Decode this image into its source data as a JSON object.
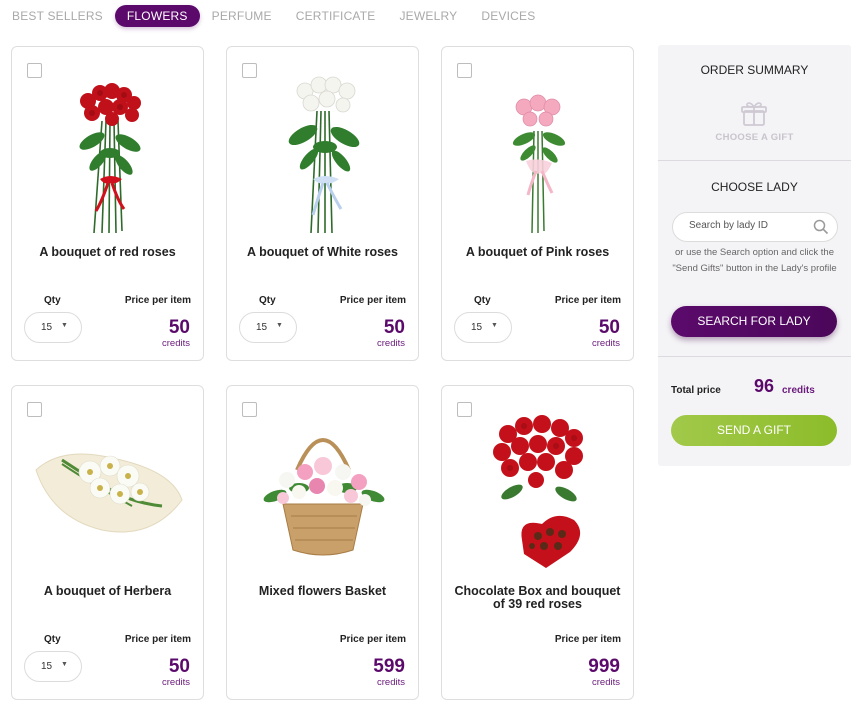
{
  "tabs": [
    {
      "label": "BEST SELLERS",
      "active": false
    },
    {
      "label": "FLOWERS",
      "active": true
    },
    {
      "label": "PERFUME",
      "active": false
    },
    {
      "label": "CERTIFICATE",
      "active": false
    },
    {
      "label": "JEWELRY",
      "active": false
    },
    {
      "label": "DEVICES",
      "active": false
    }
  ],
  "products": [
    {
      "title": "A bouquet of red roses",
      "qty_label": "Qty",
      "qty": "15",
      "price_label": "Price per item",
      "price": "50",
      "unit": "credits",
      "image": "red-roses-bouquet"
    },
    {
      "title": "A bouquet of White roses",
      "qty_label": "Qty",
      "qty": "15",
      "price_label": "Price per item",
      "price": "50",
      "unit": "credits",
      "image": "white-roses-bouquet"
    },
    {
      "title": "A bouquet of Pink roses",
      "qty_label": "Qty",
      "qty": "15",
      "price_label": "Price per item",
      "price": "50",
      "unit": "credits",
      "image": "pink-roses-bouquet"
    },
    {
      "title": "A bouquet of Herbera",
      "qty_label": "Qty",
      "qty": "15",
      "price_label": "Price per item",
      "price": "50",
      "unit": "credits",
      "image": "gerbera-bouquet"
    },
    {
      "title": "Mixed flowers Basket",
      "qty_label": "",
      "qty": "",
      "price_label": "Price per item",
      "price": "599",
      "unit": "credits",
      "image": "flower-basket"
    },
    {
      "title": "Chocolate Box and bouquet of 39 red roses",
      "qty_label": "",
      "qty": "",
      "price_label": "Price per item",
      "price": "999",
      "unit": "credits",
      "image": "roses-and-chocolate-box"
    }
  ],
  "sidebar": {
    "order_summary": "ORDER SUMMARY",
    "choose_gift": "CHOOSE A GIFT",
    "choose_lady": "CHOOSE LADY",
    "search_placeholder": "Search by lady ID",
    "hint": "or use the Search option and click the \"Send Gifts\" button in the Lady's profile",
    "search_button": "SEARCH FOR LADY",
    "total_label": "Total price",
    "total_value": "96",
    "total_unit": "credits",
    "send_button": "SEND A GIFT"
  },
  "colors": {
    "accent": "#5b0a6b",
    "send_green": "#94c23a",
    "muted_tab": "#a9a9a9"
  }
}
